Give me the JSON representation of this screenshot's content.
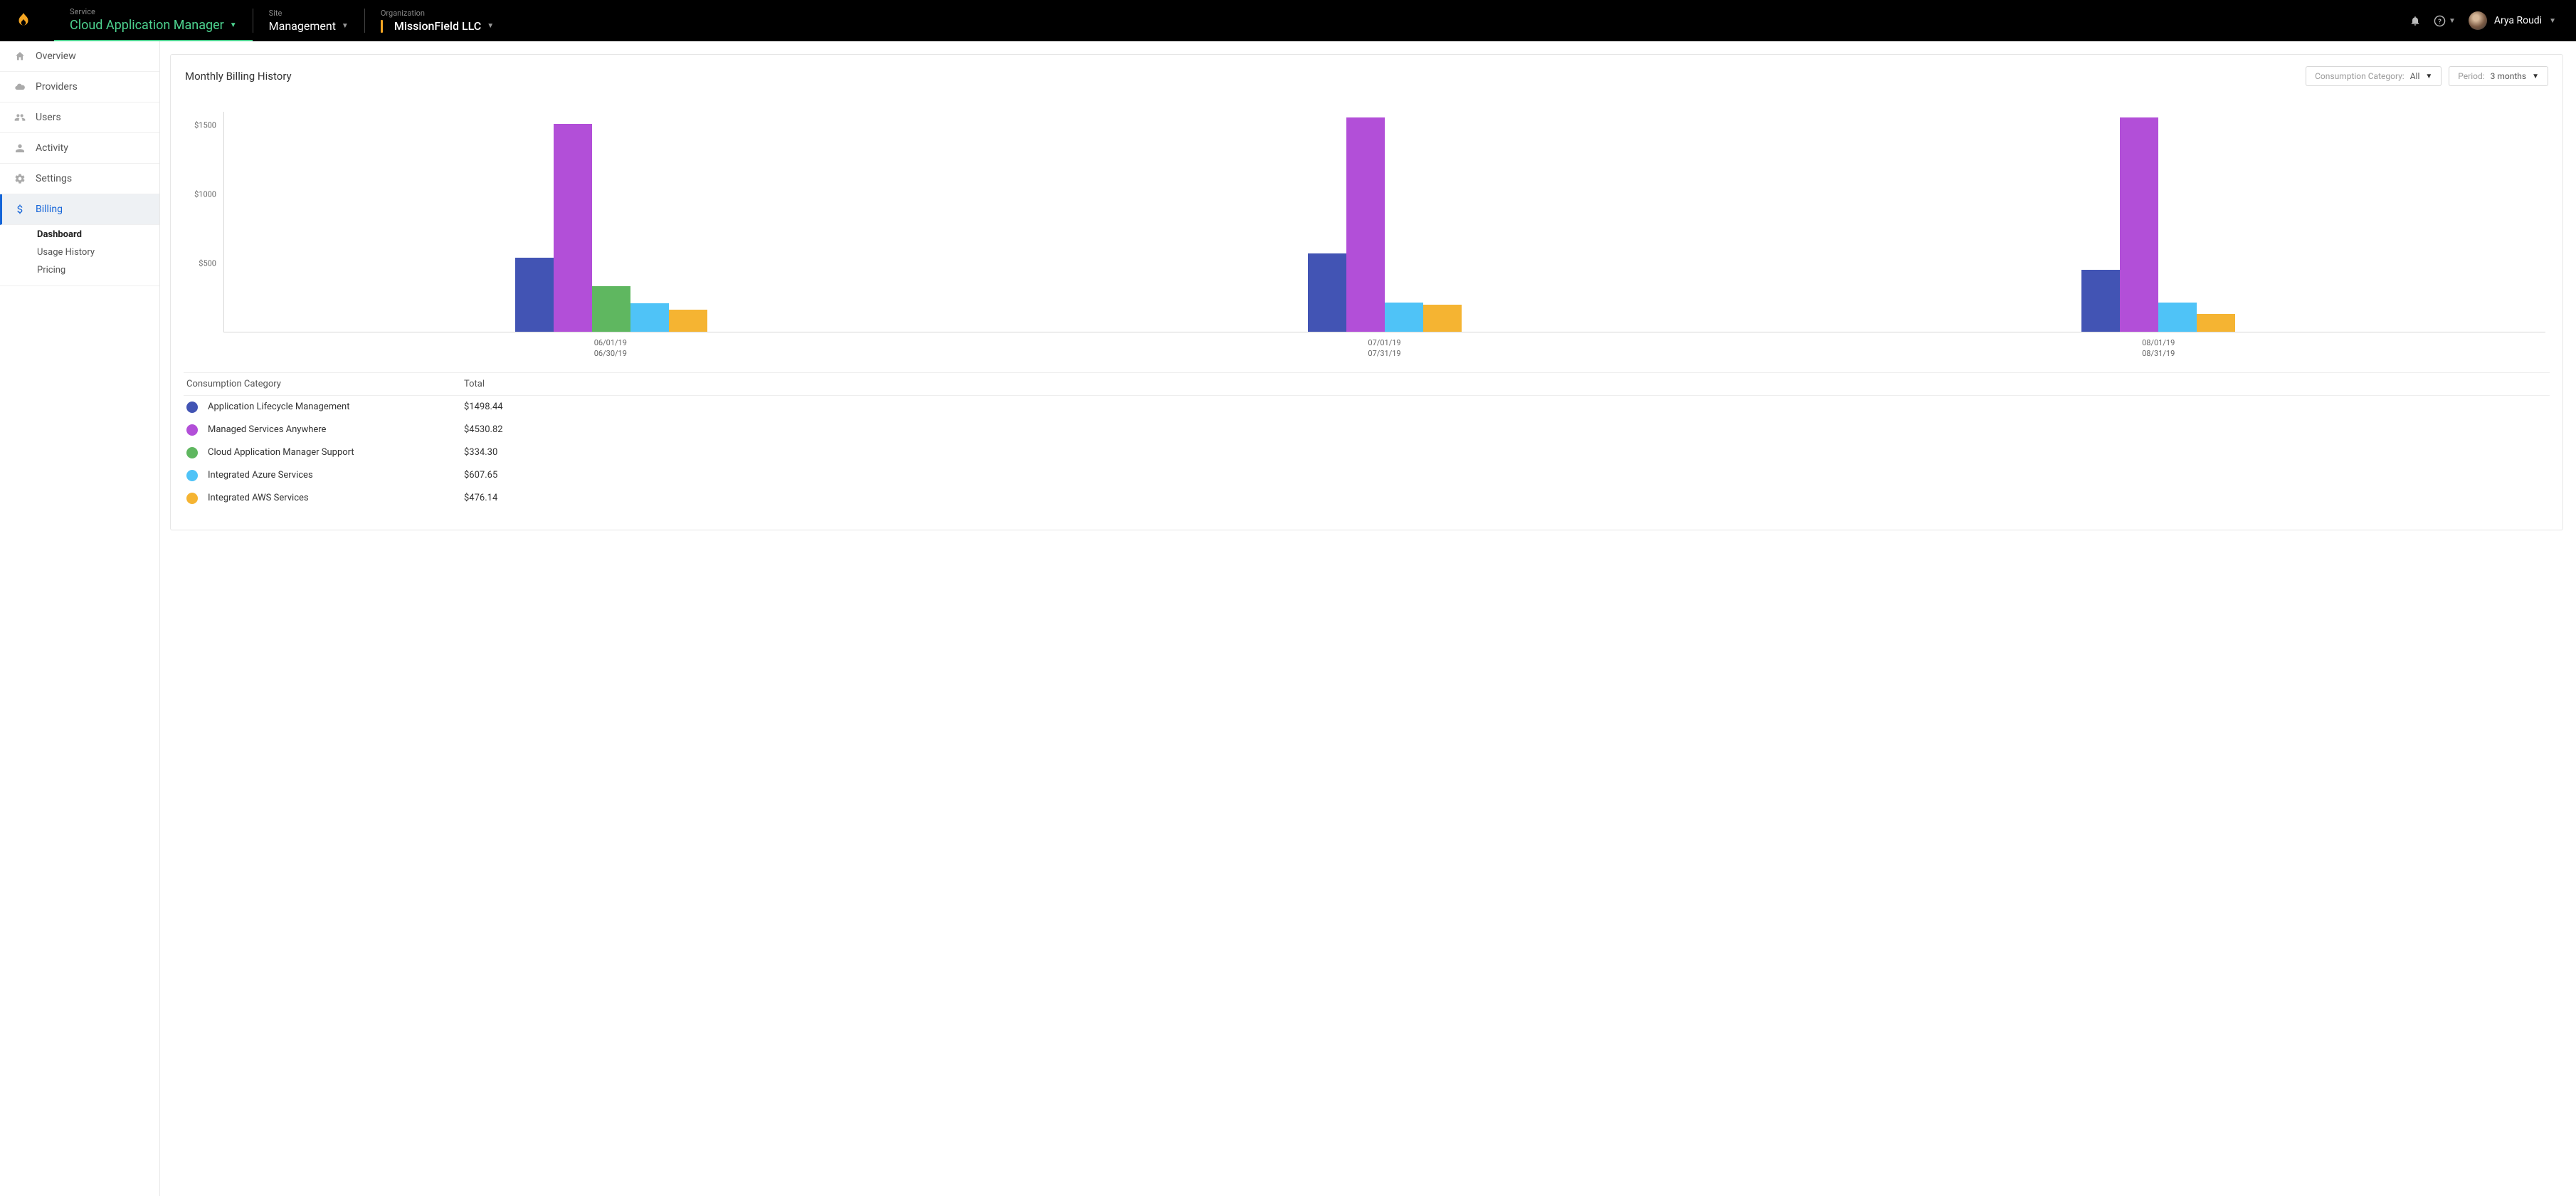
{
  "topbar": {
    "service_label": "Service",
    "service_value": "Cloud Application Manager",
    "site_label": "Site",
    "site_value": "Management",
    "org_label": "Organization",
    "org_value": "MissionField LLC",
    "user_name": "Arya Roudi"
  },
  "sidebar": {
    "items": [
      {
        "id": "overview",
        "label": "Overview",
        "icon": "home"
      },
      {
        "id": "providers",
        "label": "Providers",
        "icon": "cloud"
      },
      {
        "id": "users",
        "label": "Users",
        "icon": "users"
      },
      {
        "id": "activity",
        "label": "Activity",
        "icon": "people"
      },
      {
        "id": "settings",
        "label": "Settings",
        "icon": "gear"
      },
      {
        "id": "billing",
        "label": "Billing",
        "icon": "dollar",
        "active": true
      }
    ],
    "billing_sub": [
      {
        "label": "Dashboard",
        "active": true
      },
      {
        "label": "Usage History"
      },
      {
        "label": "Pricing"
      }
    ]
  },
  "page": {
    "title": "Monthly Billing History",
    "filters": {
      "category_label": "Consumption Category:",
      "category_value": "All",
      "period_label": "Period:",
      "period_value": "3 months"
    },
    "table": {
      "header_category": "Consumption Category",
      "header_total": "Total",
      "rows": [
        {
          "label": "Application Lifecycle Management",
          "total": "$1498.44",
          "color": "#4254b4"
        },
        {
          "label": "Managed Services Anywhere",
          "total": "$4530.82",
          "color": "#b24fd8"
        },
        {
          "label": "Cloud Application Manager Support",
          "total": "$334.30",
          "color": "#5fb760"
        },
        {
          "label": "Integrated Azure Services",
          "total": "$607.65",
          "color": "#4fc3f7"
        },
        {
          "label": "Integrated AWS Services",
          "total": "$476.14",
          "color": "#f5b432"
        }
      ]
    }
  },
  "chart_data": {
    "type": "bar",
    "ylabel": "",
    "xlabel": "",
    "ylim": [
      0,
      1600
    ],
    "y_ticks": [
      "$1500",
      "$1000",
      "$500"
    ],
    "categories": [
      {
        "line1": "06/01/19",
        "line2": "06/30/19"
      },
      {
        "line1": "07/01/19",
        "line2": "07/31/19"
      },
      {
        "line1": "08/01/19",
        "line2": "08/31/19"
      }
    ],
    "series": [
      {
        "name": "Application Lifecycle Management",
        "color": "#4254b4",
        "values": [
          540,
          570,
          450
        ]
      },
      {
        "name": "Managed Services Anywhere",
        "color": "#b24fd8",
        "values": [
          1510,
          1560,
          1560
        ]
      },
      {
        "name": "Cloud Application Manager Support",
        "color": "#5fb760",
        "values": [
          334,
          0,
          0
        ]
      },
      {
        "name": "Integrated Azure Services",
        "color": "#4fc3f7",
        "values": [
          205,
          210,
          210
        ]
      },
      {
        "name": "Integrated AWS Services",
        "color": "#f5b432",
        "values": [
          160,
          195,
          130
        ]
      }
    ]
  }
}
